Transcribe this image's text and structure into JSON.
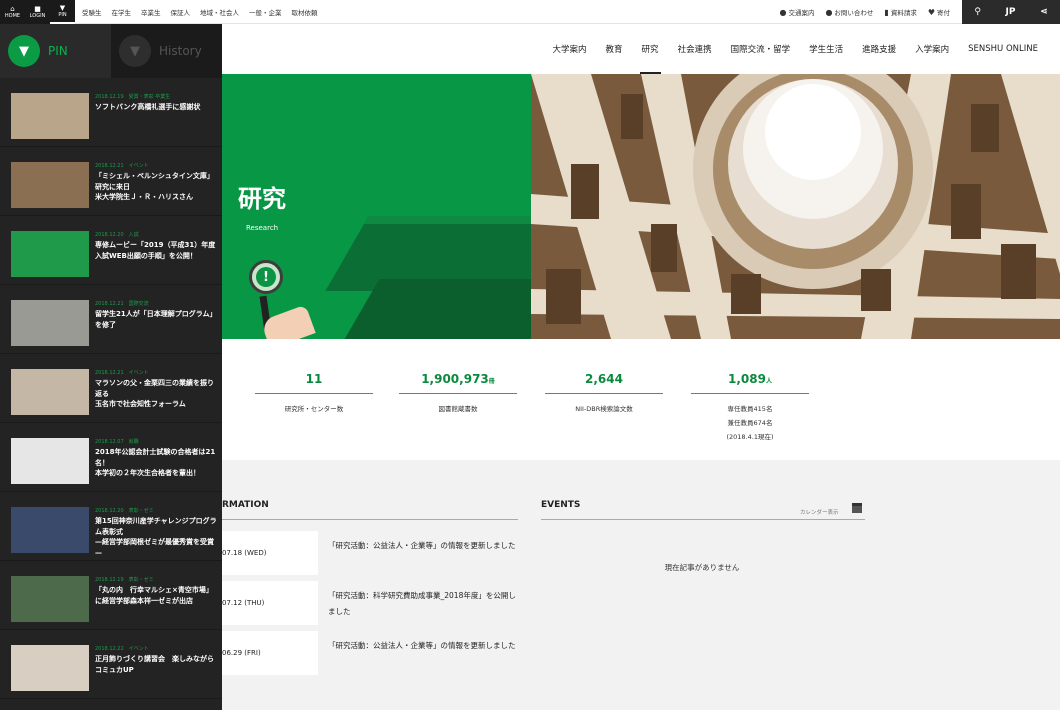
{
  "topbar": {
    "left_buttons": [
      {
        "label": "HOME",
        "icon": "home-icon"
      },
      {
        "label": "LOGIN",
        "icon": "lock-icon"
      },
      {
        "label": "PIN",
        "icon": "pin-icon"
      }
    ],
    "audience_links": [
      "受験生",
      "在学生",
      "卒業生",
      "保証人",
      "地域・社会人",
      "一般・企業",
      "取材依頼"
    ],
    "utility_links": [
      {
        "label": "交通案内",
        "icon": "map-pin-icon"
      },
      {
        "label": "お問い合わせ",
        "icon": "info-icon"
      },
      {
        "label": "資料請求",
        "icon": "book-icon"
      },
      {
        "label": "寄付",
        "icon": "heart-icon"
      }
    ],
    "search_icon": "search-icon",
    "language": "JP",
    "share_icon": "share-icon"
  },
  "mainnav": {
    "items": [
      "大学案内",
      "教育",
      "研究",
      "社会連携",
      "国際交流・留学",
      "学生生活",
      "進路支援",
      "入学案内",
      "SENSHU ONLINE"
    ],
    "active": "研究"
  },
  "hero": {
    "title": "研究",
    "subtitle": "Research"
  },
  "stats": [
    {
      "value": "11",
      "unit": "",
      "label": "研究所・センター数"
    },
    {
      "value": "1,900,973",
      "unit": "冊",
      "label": "図書館蔵書数"
    },
    {
      "value": "2,644",
      "unit": "",
      "label": "NII-DBR検索論文数"
    },
    {
      "value": "1,089",
      "unit": "人",
      "label": "専任教員415名",
      "label2": "兼任教員674名",
      "label3": "(2018.4.1現在)"
    }
  ],
  "information": {
    "title": "RMATION",
    "items": [
      {
        "date": "07.18 (WED)",
        "text": "「研究活動：公益法人・企業等」の情報を更新しました"
      },
      {
        "date": "07.12 (THU)",
        "text": "「研究活動：科学研究費助成事業_2018年度」を公開しました"
      },
      {
        "date": "06.29 (FRI)",
        "text": "「研究活動：公益法人・企業等」の情報を更新しました"
      }
    ]
  },
  "events": {
    "title": "EVENTS",
    "calendar_link": "カレンダー表示",
    "empty_text": "現在記事がありません"
  },
  "sidebar": {
    "tabs": [
      {
        "label": "PIN",
        "icon": "pin-icon"
      },
      {
        "label": "History",
        "icon": "history-icon"
      }
    ],
    "items": [
      {
        "date": "2018.12.19",
        "cat": "受賞・表彰 卒業生",
        "title": "ソフトバンク高橋礼選手に感謝状"
      },
      {
        "date": "2018.12.21",
        "cat": "イベント",
        "title": "「ミシェル・ペルンシュタイン文庫」研究に来日\n米大学院生Ｊ・Ｒ・ハリスさん"
      },
      {
        "date": "2018.12.20",
        "cat": "入試",
        "title": "専修ムービー「2019（平成31）年度入試WEB出願の手順」を公開！"
      },
      {
        "date": "2018.12.21",
        "cat": "国際交流",
        "title": "留学生21人が「日本理解プログラム」を修了"
      },
      {
        "date": "2018.12.21",
        "cat": "イベント",
        "title": "マラソンの父・金栗四三の業績を振り返る\n玉名市で社会知性フォーラム"
      },
      {
        "date": "2018.12.07",
        "cat": "就職",
        "title": "2018年公認会計士試験の合格者は21名！\n本学初の２年次生合格者を輩出！"
      },
      {
        "date": "2018.12.20",
        "cat": "表彰・ゼミ",
        "title": "第15回神奈川産学チャレンジプログラム表彰式\n—経営学部岡根ゼミが最優秀賞を受賞—"
      },
      {
        "date": "2018.12.19",
        "cat": "表彰・ゼミ",
        "title": "「丸の内　行幸マルシェ×青空市場」に経営学部森本祥一ゼミが出店"
      },
      {
        "date": "2018.12.22",
        "cat": "イベント",
        "title": "正月飾りづくり講習会　楽しみながらコミュカUP"
      }
    ]
  },
  "colors": {
    "brand_green": "#079745",
    "sidebar_bg": "#232323",
    "accent_text": "#0a8a3c"
  }
}
